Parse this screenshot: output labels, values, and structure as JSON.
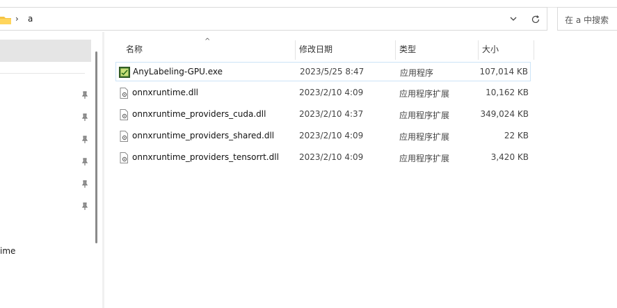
{
  "address": {
    "crumbs": [
      "a"
    ],
    "search_placeholder": "在 a 中搜索"
  },
  "sidebar": {
    "partial_label": "ime",
    "pinned_count": 6
  },
  "columns": {
    "name": "名称",
    "date": "修改日期",
    "type": "类型",
    "size": "大小"
  },
  "files": [
    {
      "name": "AnyLabeling-GPU.exe",
      "date": "2023/5/25 8:47",
      "type": "应用程序",
      "size": "107,014 KB",
      "icon": "exe-icon",
      "selected": true
    },
    {
      "name": "onnxruntime.dll",
      "date": "2023/2/10 4:09",
      "type": "应用程序扩展",
      "size": "10,162 KB",
      "icon": "dll-icon"
    },
    {
      "name": "onnxruntime_providers_cuda.dll",
      "date": "2023/2/10 4:37",
      "type": "应用程序扩展",
      "size": "349,024 KB",
      "icon": "dll-icon"
    },
    {
      "name": "onnxruntime_providers_shared.dll",
      "date": "2023/2/10 4:09",
      "type": "应用程序扩展",
      "size": "22 KB",
      "icon": "dll-icon"
    },
    {
      "name": "onnxruntime_providers_tensorrt.dll",
      "date": "2023/2/10 4:09",
      "type": "应用程序扩展",
      "size": "3,420 KB",
      "icon": "dll-icon"
    }
  ],
  "colors": {
    "selection_border": "#cce4f7",
    "sidebar_selected": "#e5e5e5"
  }
}
